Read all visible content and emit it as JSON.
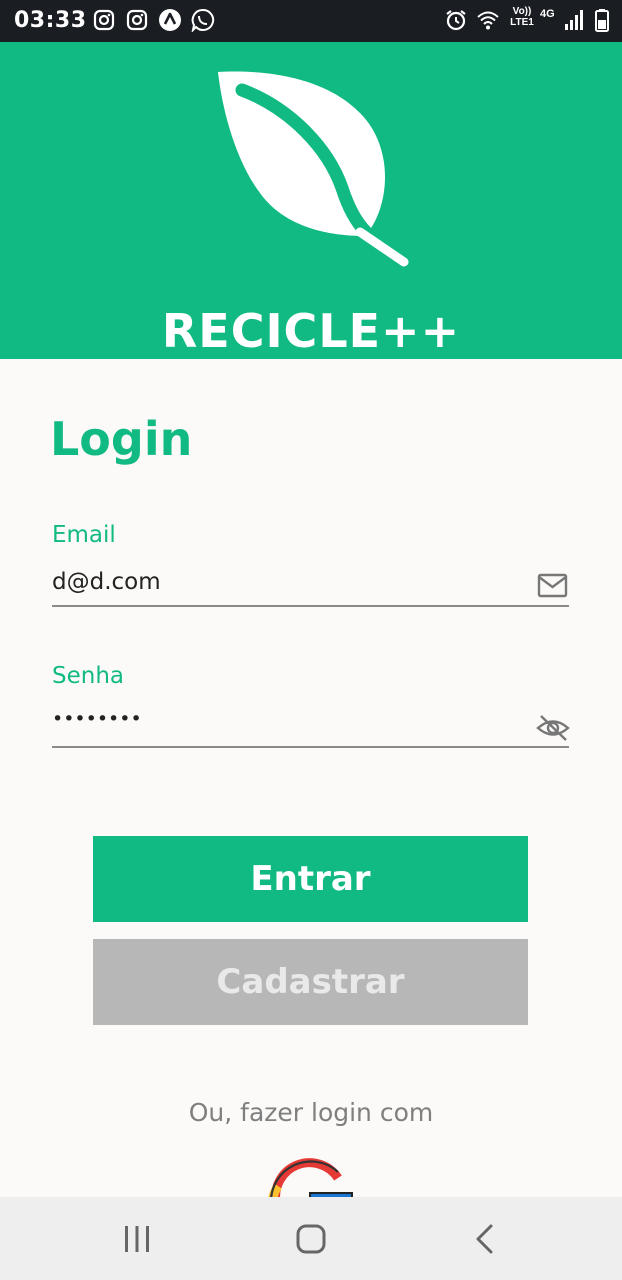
{
  "status_bar": {
    "time": "03:33",
    "left_icons": [
      "instagram-icon",
      "instagram-icon",
      "arrow-app-icon",
      "whatsapp-icon"
    ],
    "right_icons": [
      "alarm-icon",
      "wifi-icon",
      "volte-icon",
      "signal-icon",
      "battery-icon"
    ],
    "volte_label": "Vo)) LTE1",
    "network_label": "4G"
  },
  "header": {
    "brand": "RECICLE++",
    "accent_color": "#12ba83"
  },
  "login": {
    "title": "Login",
    "email_label": "Email",
    "email_value": "d@d.com",
    "password_label": "Senha",
    "password_value": "••••••••"
  },
  "buttons": {
    "enter": "Entrar",
    "register": "Cadastrar"
  },
  "alt_login_text": "Ou, fazer login com",
  "nav_bar": {
    "icons": [
      "recent-apps-icon",
      "home-icon",
      "back-icon"
    ]
  }
}
